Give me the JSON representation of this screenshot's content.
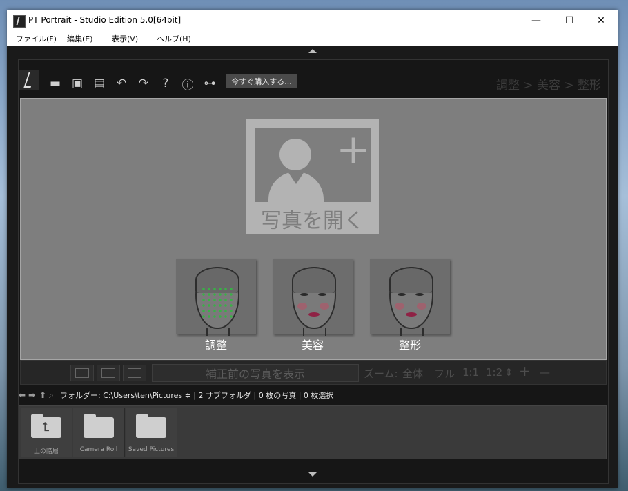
{
  "window": {
    "title": "PT Portrait - Studio Edition 5.0[64bit]",
    "controls": {
      "minimize": "—",
      "maximize": "☐",
      "close": "✕"
    }
  },
  "menu": {
    "file": "ファイル(F)",
    "edit": "編集(E)",
    "view": "表示(V)",
    "help": "ヘルプ(H)"
  },
  "toolbar": {
    "buy_label": "今すぐ購入する...",
    "icons": [
      "folder-icon",
      "save-icon",
      "save-as-icon",
      "undo-icon",
      "redo-icon",
      "help-icon",
      "info-icon",
      "plugin-icon"
    ]
  },
  "breadcrumb": "調整 > 美容 > 整形",
  "main": {
    "open_label": "写真を開く",
    "modes": [
      {
        "label": "調整"
      },
      {
        "label": "美容"
      },
      {
        "label": "整形"
      }
    ]
  },
  "viewbar": {
    "before_label": "補正前の写真を表示",
    "zoom_label": "ズーム:",
    "zoom_options": [
      "全体",
      "フル",
      "1:1",
      "1:2"
    ],
    "zoom_in": "+",
    "zoom_out": "—"
  },
  "browser": {
    "path_text": "フォルダー:  C:\\Users\\ten\\Pictures ≑ | 2 サブフォルダ | 0 枚の写真 | 0 枚選択",
    "items": [
      {
        "label": "上の階層"
      },
      {
        "label": "Camera Roll"
      },
      {
        "label": "Saved Pictures"
      }
    ]
  }
}
